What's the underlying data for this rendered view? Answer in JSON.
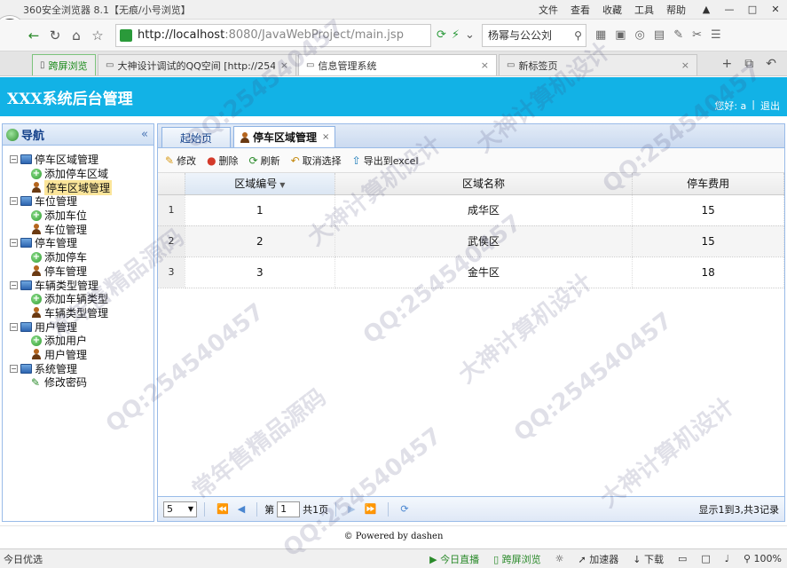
{
  "browser": {
    "window_title": "360安全浏览器 8.1【无痕/小号浏览】",
    "menus": [
      "文件",
      "查看",
      "收藏",
      "工具",
      "帮助"
    ],
    "url_host": "http://localhost",
    "url_tail": ":8080/JavaWebProject/main.jsp",
    "search_text": "杨幂与公公刘",
    "zoom": "100%",
    "tabs": [
      {
        "label": "跨屏浏览",
        "closable": false
      },
      {
        "label": "大神设计调试的QQ空间 [http://2545...",
        "closable": true
      },
      {
        "label": "信息管理系统",
        "closable": true,
        "active": true
      },
      {
        "label": "新标签页",
        "closable": true
      }
    ]
  },
  "app": {
    "title": "XXX系统后台管理",
    "greeting": "您好: a",
    "logout": "退出",
    "footer": "© Powered by dashen"
  },
  "nav": {
    "title": "导航",
    "groups": [
      {
        "label": "停车区域管理",
        "items": [
          {
            "label": "添加停车区域",
            "icon": "add-icon"
          },
          {
            "label": "停车区域管理",
            "icon": "user-icon",
            "selected": true
          }
        ]
      },
      {
        "label": "车位管理",
        "items": [
          {
            "label": "添加车位",
            "icon": "add-icon"
          },
          {
            "label": "车位管理",
            "icon": "user-icon"
          }
        ]
      },
      {
        "label": "停车管理",
        "items": [
          {
            "label": "添加停车",
            "icon": "add-icon"
          },
          {
            "label": "停车管理",
            "icon": "user-icon"
          }
        ]
      },
      {
        "label": "车辆类型管理",
        "items": [
          {
            "label": "添加车辆类型",
            "icon": "add-icon"
          },
          {
            "label": "车辆类型管理",
            "icon": "user-icon"
          }
        ]
      },
      {
        "label": "用户管理",
        "items": [
          {
            "label": "添加用户",
            "icon": "add-icon"
          },
          {
            "label": "用户管理",
            "icon": "user-icon"
          }
        ]
      },
      {
        "label": "系统管理",
        "items": [
          {
            "label": "修改密码",
            "icon": "pen-icon"
          }
        ]
      }
    ]
  },
  "main": {
    "tabs": [
      {
        "label": "起始页"
      },
      {
        "label": "停车区域管理",
        "active": true
      }
    ],
    "toolbar": {
      "edit": "修改",
      "delete": "删除",
      "refresh": "刷新",
      "cancel_select": "取消选择",
      "export": "导出到excel"
    },
    "grid": {
      "columns": [
        "区域编号",
        "区域名称",
        "停车费用"
      ],
      "rows": [
        {
          "num": "1",
          "id": "1",
          "name": "成华区",
          "fee": "15"
        },
        {
          "num": "2",
          "id": "2",
          "name": "武侯区",
          "fee": "15"
        },
        {
          "num": "3",
          "id": "3",
          "name": "金牛区",
          "fee": "18"
        }
      ]
    },
    "pager": {
      "page_size": "5",
      "page_prefix": "第",
      "page_value": "1",
      "page_total": "共1页",
      "info": "显示1到3,共3记录"
    }
  },
  "statusbar": {
    "left": "今日优选",
    "live": "今日直播",
    "split": "跨屏浏览",
    "accelerate": "加速器",
    "download": "下载"
  },
  "watermarks": [
    "QQ:254540457",
    "大神计算机设计",
    "常年售精品源码"
  ]
}
